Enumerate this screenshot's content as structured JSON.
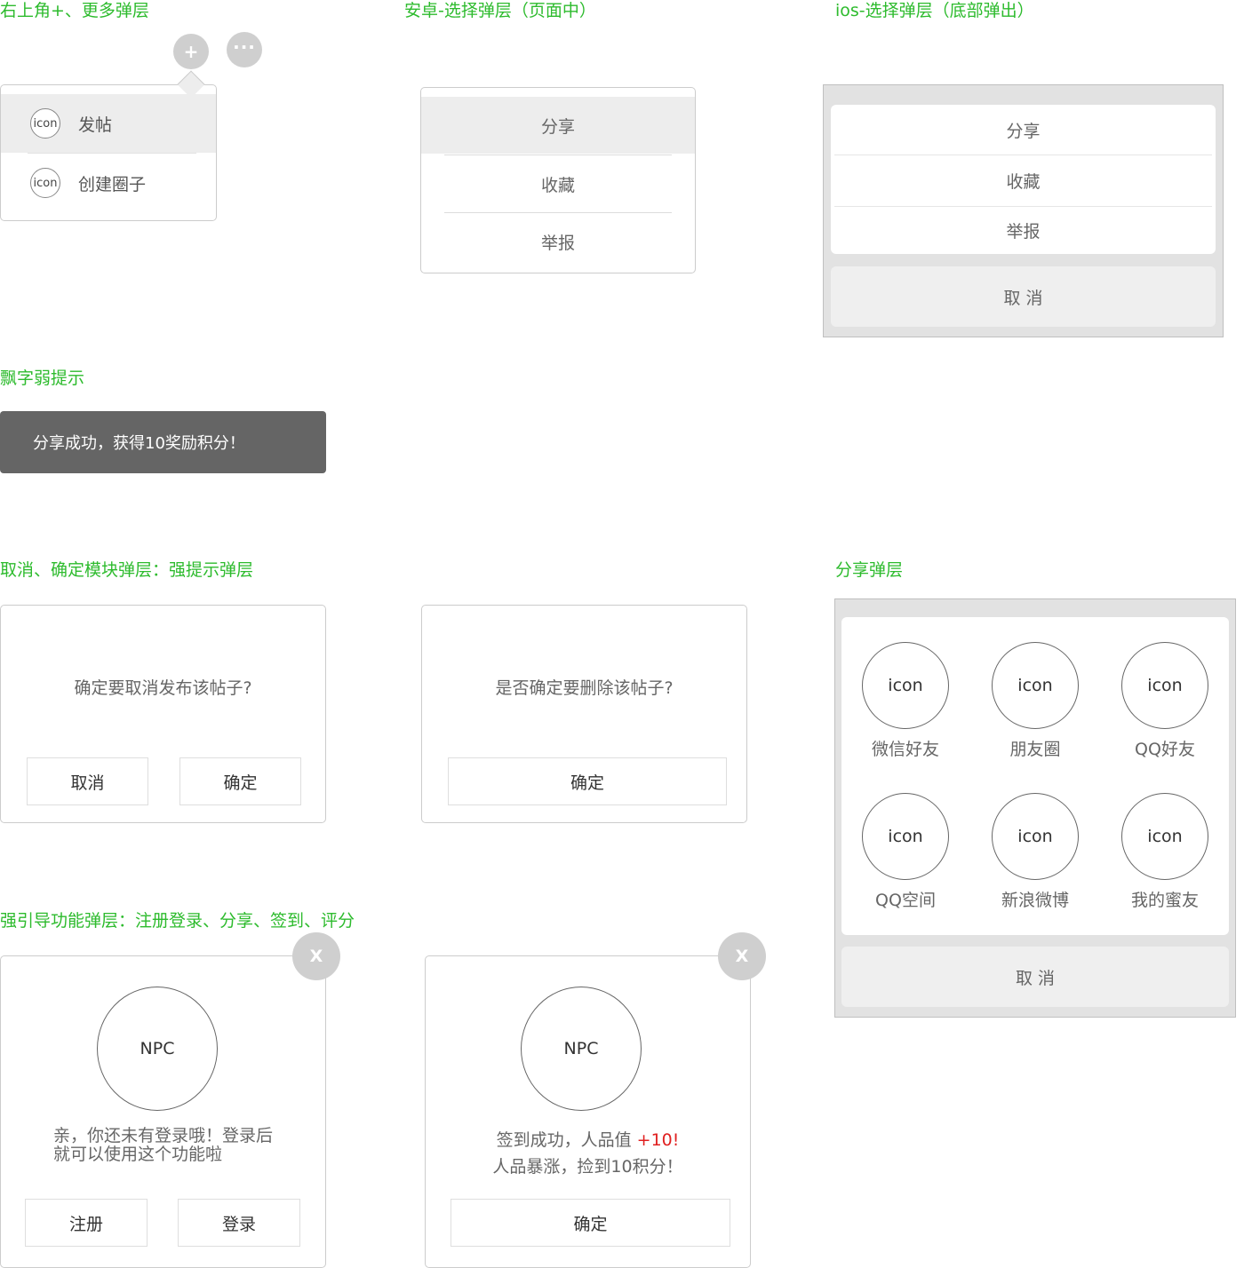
{
  "sections": {
    "top_right": "右上角+、更多弹层",
    "android": "安卓-选择弹层（页面中）",
    "ios": "ios-选择弹层（底部弹出）",
    "toast": "飘字弱提示",
    "confirm": "取消、确定模块弹层：强提示弹层",
    "share": "分享弹层",
    "guide": "强引导功能弹层：注册登录、分享、签到、评分"
  },
  "top_right_popover": {
    "plus_symbol": "+",
    "more_symbol": "···",
    "items": [
      {
        "icon": "icon",
        "label": "发帖"
      },
      {
        "icon": "icon",
        "label": "创建圈子"
      }
    ]
  },
  "android_select": {
    "items": [
      "分享",
      "收藏",
      "举报"
    ]
  },
  "ios_sheet": {
    "items": [
      "分享",
      "收藏",
      "举报"
    ],
    "cancel": "取 消"
  },
  "toast": {
    "text": "分享成功，获得10奖励积分！"
  },
  "confirm_dialogs": [
    {
      "message": "确定要取消发布该帖子?",
      "cancel": "取消",
      "ok": "确定"
    },
    {
      "message": "是否确定要删除该帖子?",
      "ok": "确定"
    }
  ],
  "share_sheet": {
    "items": [
      {
        "icon": "icon",
        "label": "微信好友"
      },
      {
        "icon": "icon",
        "label": "朋友圈"
      },
      {
        "icon": "icon",
        "label": "QQ好友"
      },
      {
        "icon": "icon",
        "label": "QQ空间"
      },
      {
        "icon": "icon",
        "label": "新浪微博"
      },
      {
        "icon": "icon",
        "label": "我的蜜友"
      }
    ],
    "cancel": "取 消"
  },
  "guide_dialogs": [
    {
      "close": "X",
      "npc": "NPC",
      "line1": "亲，你还未有登录哦！登录后",
      "line2": "就可以使用这个功能啦",
      "register": "注册",
      "login": "登录"
    },
    {
      "close": "X",
      "npc": "NPC",
      "line1_prefix": "签到成功，人品值 ",
      "line1_highlight": "+10",
      "line1_suffix": "!",
      "line2": "人品暴涨，捡到10积分！",
      "ok": "确定"
    }
  ],
  "colors": {
    "section_title": "#2dbb2d",
    "highlight_red": "#e02020",
    "toast_bg": "#656565"
  }
}
